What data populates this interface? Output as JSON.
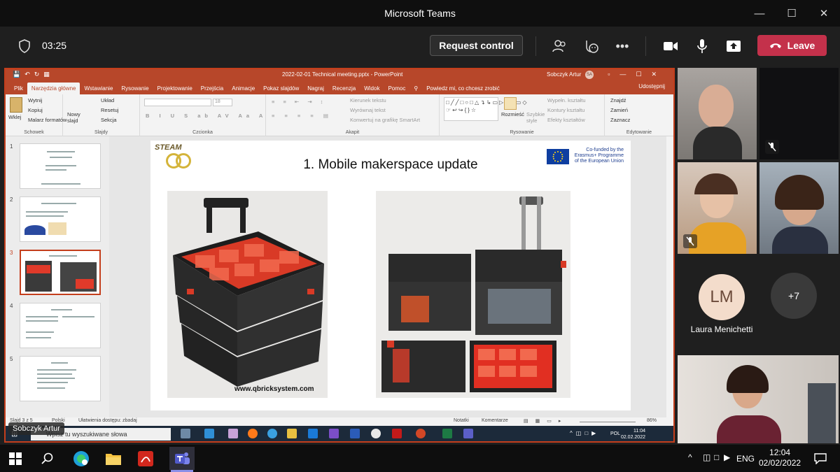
{
  "teams": {
    "window_title": "Microsoft Teams",
    "call_timer": "03:25",
    "request_control_label": "Request control",
    "leave_label": "Leave"
  },
  "powerpoint": {
    "title": "2022-02-01 Technical meeting.pptx - PowerPoint",
    "user": "Sobczyk Artur",
    "user_initials": "SA",
    "tabs": [
      "Plik",
      "Narzędzia główne",
      "Wstawianie",
      "Rysowanie",
      "Projektowanie",
      "Przejścia",
      "Animacje",
      "Pokaz slajdów",
      "Nagraj",
      "Recenzja",
      "Widok",
      "Pomoc"
    ],
    "active_tab": "Narzędzia główne",
    "tell_me": "Powiedz mi, co chcesz zrobić",
    "share": "Udostępnij",
    "ribbon": {
      "clipboard": {
        "paste": "Wklej",
        "cut": "Wytnij",
        "copy": "Kopiuj",
        "format_painter": "Malarz formatów",
        "group": "Schowek"
      },
      "slides": {
        "new_slide": "Nowy slajd",
        "layout": "Układ",
        "reset": "Resetuj",
        "section": "Sekcja",
        "group": "Slajdy"
      },
      "font": {
        "size": "18",
        "group": "Czcionka"
      },
      "paragraph": {
        "text_direction": "Kierunek tekstu",
        "align_text": "Wyrównaj tekst",
        "smartart": "Konwertuj na grafikę SmartArt",
        "group": "Akapit"
      },
      "drawing": {
        "arrange": "Rozmieść",
        "quick_styles": "Szybkie style",
        "shape_fill": "Wypełn. kształtu",
        "shape_outline": "Kontury kształtu",
        "shape_effects": "Efekty kształtów",
        "group": "Rysowanie"
      },
      "editing": {
        "find": "Znajdź",
        "replace": "Zamień",
        "select": "Zaznacz",
        "group": "Edytowanie"
      }
    },
    "thumbnails": [
      "1",
      "2",
      "3",
      "4",
      "5"
    ],
    "selected_slide": "3",
    "slide": {
      "title": "1. Mobile makerspace update",
      "logo_text": "STEAM",
      "eu_text": [
        "Co-funded by the",
        "Erasmus+ Programme",
        "of the European Union"
      ],
      "url": "www.qbricksystem.com"
    },
    "status": {
      "slide_info": "Slajd 3 z 5",
      "language": "Polski",
      "accessibility": "Ułatwienia dostępu: zbadaj",
      "notes": "Notatki",
      "comments": "Komentarze",
      "zoom": "86%"
    },
    "remote_taskbar": {
      "search_placeholder": "Wpisz tu wyszukiwane słowa",
      "lang": "POL",
      "time": "11:04",
      "date": "02.02.2022"
    }
  },
  "presenter_name": "Sobczyk Artur",
  "participants": {
    "lm_initials": "LM",
    "lm_name": "Laura Menichetti",
    "overflow": "+7"
  },
  "windows_taskbar": {
    "lang": "ENG",
    "time": "12:04",
    "date": "02/02/2022"
  }
}
